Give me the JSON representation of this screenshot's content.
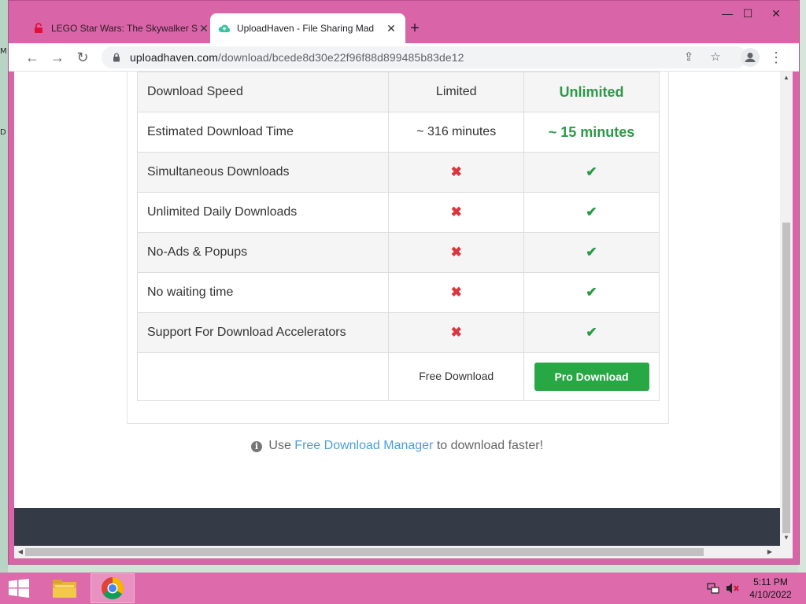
{
  "desktop": {
    "left_letters": [
      "M",
      "D"
    ]
  },
  "browser": {
    "tabs": [
      {
        "title": "LEGO Star Wars: The Skywalker S",
        "icon": "lock-red-icon",
        "active": false
      },
      {
        "title": "UploadHaven - File Sharing Mad",
        "icon": "uploadhaven-cloud-icon",
        "active": true
      }
    ],
    "new_tab_label": "+",
    "window_controls": {
      "minimize": "—",
      "maximize": "☐",
      "close": "✕"
    },
    "url_host": "uploadhaven.com",
    "url_path": "/download/bcede8d30e22f96f88d899485b83de12"
  },
  "comparison": {
    "rows": [
      {
        "feature": "Download Speed",
        "free": "Limited",
        "pro": "Unlimited",
        "kind": "text"
      },
      {
        "feature": "Estimated Download Time",
        "free": "~ 316 minutes",
        "pro": "~ 15 minutes",
        "kind": "text"
      },
      {
        "feature": "Simultaneous Downloads",
        "free": "✖",
        "pro": "✔",
        "kind": "mark"
      },
      {
        "feature": "Unlimited Daily Downloads",
        "free": "✖",
        "pro": "✔",
        "kind": "mark"
      },
      {
        "feature": "No-Ads & Popups",
        "free": "✖",
        "pro": "✔",
        "kind": "mark"
      },
      {
        "feature": "No waiting time",
        "free": "✖",
        "pro": "✔",
        "kind": "mark"
      },
      {
        "feature": "Support For Download Accelerators",
        "free": "✖",
        "pro": "✔",
        "kind": "mark"
      }
    ],
    "free_download_label": "Free Download",
    "pro_download_label": "Pro Download"
  },
  "note": {
    "prefix": "Use",
    "link": "Free Download Manager",
    "suffix": "to download faster!"
  },
  "taskbar": {
    "time": "5:11 PM",
    "date": "4/10/2022"
  },
  "colors": {
    "accent_green": "#28a745",
    "cross_red": "#d9363e",
    "window_frame": "#d965a8",
    "link_blue": "#4a9fd8"
  }
}
